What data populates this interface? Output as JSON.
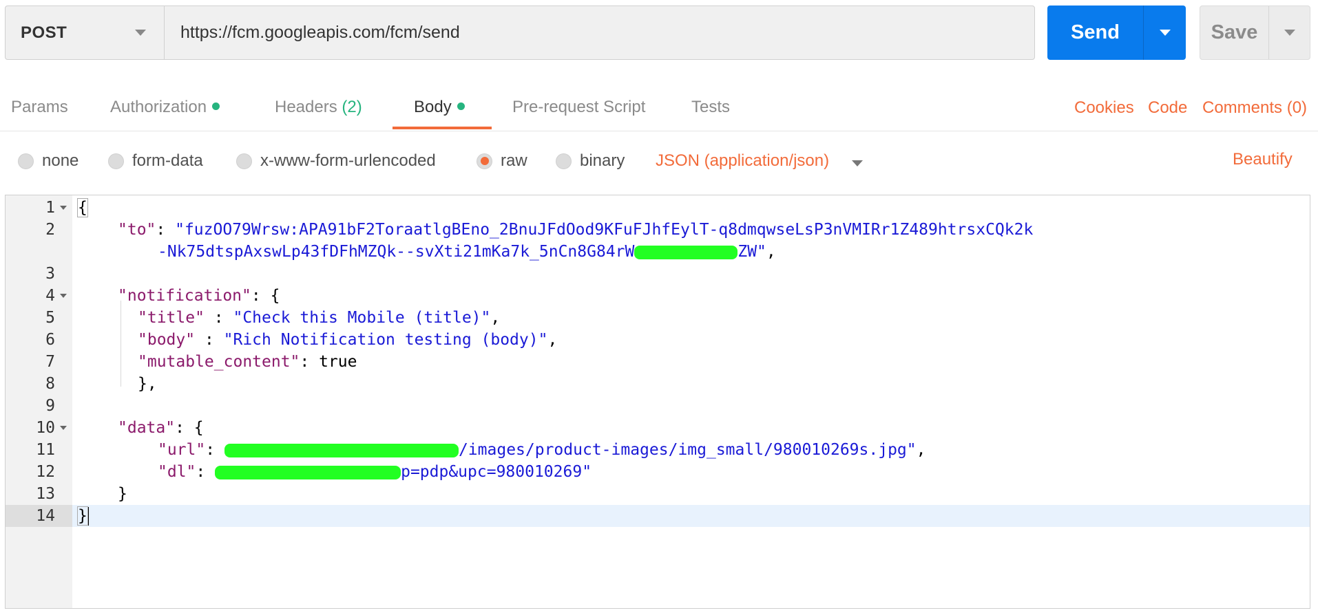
{
  "request": {
    "method": "POST",
    "url": "https://fcm.googleapis.com/fcm/send"
  },
  "buttons": {
    "send": "Send",
    "save": "Save"
  },
  "tabs": [
    {
      "label": "Params"
    },
    {
      "label": "Authorization",
      "dot": true
    },
    {
      "label": "Headers",
      "count": "(2)"
    },
    {
      "label": "Body",
      "dot": true,
      "active": true
    },
    {
      "label": "Pre-request Script"
    },
    {
      "label": "Tests"
    }
  ],
  "side_links": {
    "cookies": "Cookies",
    "code": "Code",
    "comments": "Comments (0)"
  },
  "body_types": {
    "none": "none",
    "form_data": "form-data",
    "urlencoded": "x-www-form-urlencoded",
    "raw": "raw",
    "binary": "binary",
    "selected": "raw",
    "content_type": "JSON (application/json)",
    "beautify": "Beautify"
  },
  "editor": {
    "line_numbers": [
      "1",
      "2",
      "3",
      "4",
      "5",
      "6",
      "7",
      "8",
      "9",
      "10",
      "11",
      "12",
      "13",
      "14"
    ],
    "active_line": 14,
    "to_key": "\"to\"",
    "to_value_1": "\"fuzOO79Wrsw:APA91bF2ToraatlgBEno_2BnuJFdOod9KFuFJhfEylT-q8dmqwseLsP3nVMIRr1Z489htrsxCQk2k",
    "to_value_2": "-Nk75dtspAxswLp43fDFhMZQk--svXti21mKa7k_5nCn8G84rW",
    "to_value_3": "ZW\"",
    "notification_key": "\"notification\"",
    "title_key": "\"title\"",
    "title_value": "\"Check this Mobile (title)\"",
    "body_key": "\"body\"",
    "body_value": "\"Rich Notification testing (body)\"",
    "mutable_key": "\"mutable_content\"",
    "mutable_value": "true",
    "data_key": "\"data\"",
    "url_key": "\"url\"",
    "url_value_tail": "/images/product-images/img_small/980010269s.jpg\"",
    "dl_key": "\"dl\"",
    "dl_value_tail": "p=pdp&upc=980010269\""
  }
}
